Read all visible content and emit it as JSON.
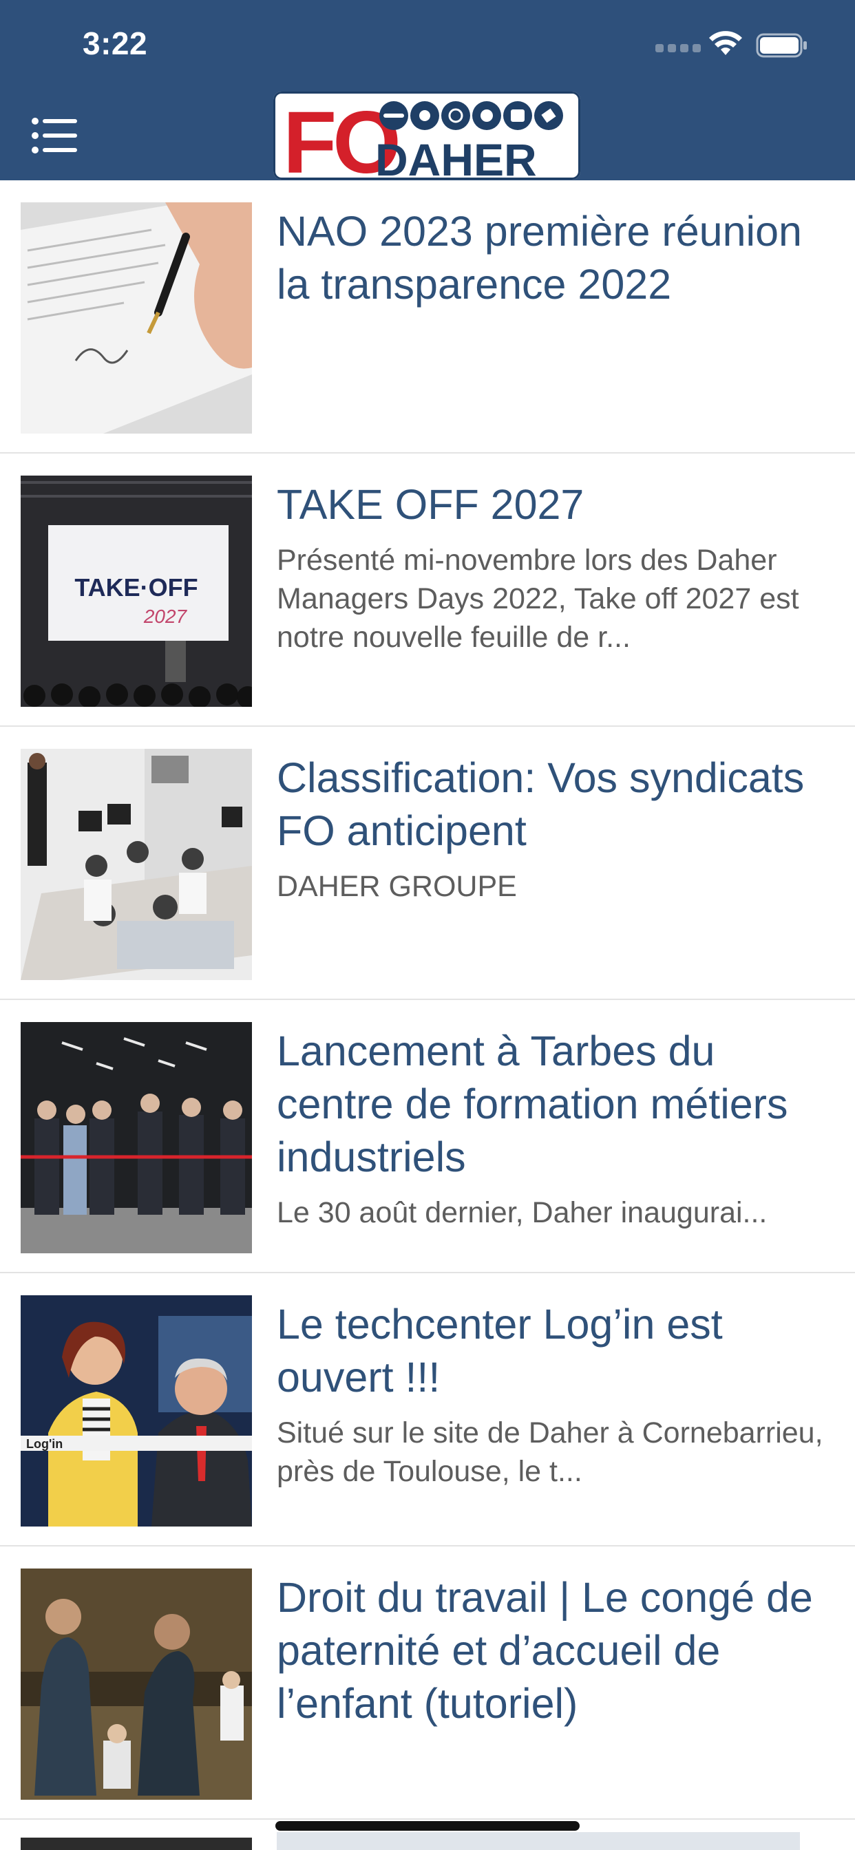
{
  "status_bar": {
    "time": "3:22"
  },
  "header": {
    "logo_text": "FO",
    "logo_subtext": "DAHER"
  },
  "colors": {
    "header_bg": "#2e507b",
    "title": "#2f5179",
    "excerpt": "#5d5d5d"
  },
  "articles": [
    {
      "title": "NAO 2023 première réunion la transparence 2022",
      "excerpt": ""
    },
    {
      "title": "TAKE OFF 2027",
      "excerpt": "Présenté mi-novembre lors des Daher Managers Days 2022, Take off 2027 est notre nouvelle feuille de r...",
      "image_text": "TAKE·OFF",
      "image_year": "2027"
    },
    {
      "title": "Classification: Vos syndicats FO anticipent",
      "excerpt": "DAHER GROUPE"
    },
    {
      "title": "Lancement à Tarbes du centre de formation métiers industriels",
      "excerpt": "Le 30 août dernier, Daher inaugurai..."
    },
    {
      "title": "Le techcenter Log’in est ouvert !!!",
      "excerpt": "Situé sur le site de Daher à Cornebarrieu, près de Toulouse, le t...",
      "image_text": "Log'in"
    },
    {
      "title": "Droit du travail | Le congé de paternité et d’accueil de l’enfant (tutoriel)",
      "excerpt": ""
    }
  ],
  "icons": [
    "menu-icon",
    "wifi-icon",
    "battery-icon",
    "signal-icon"
  ]
}
